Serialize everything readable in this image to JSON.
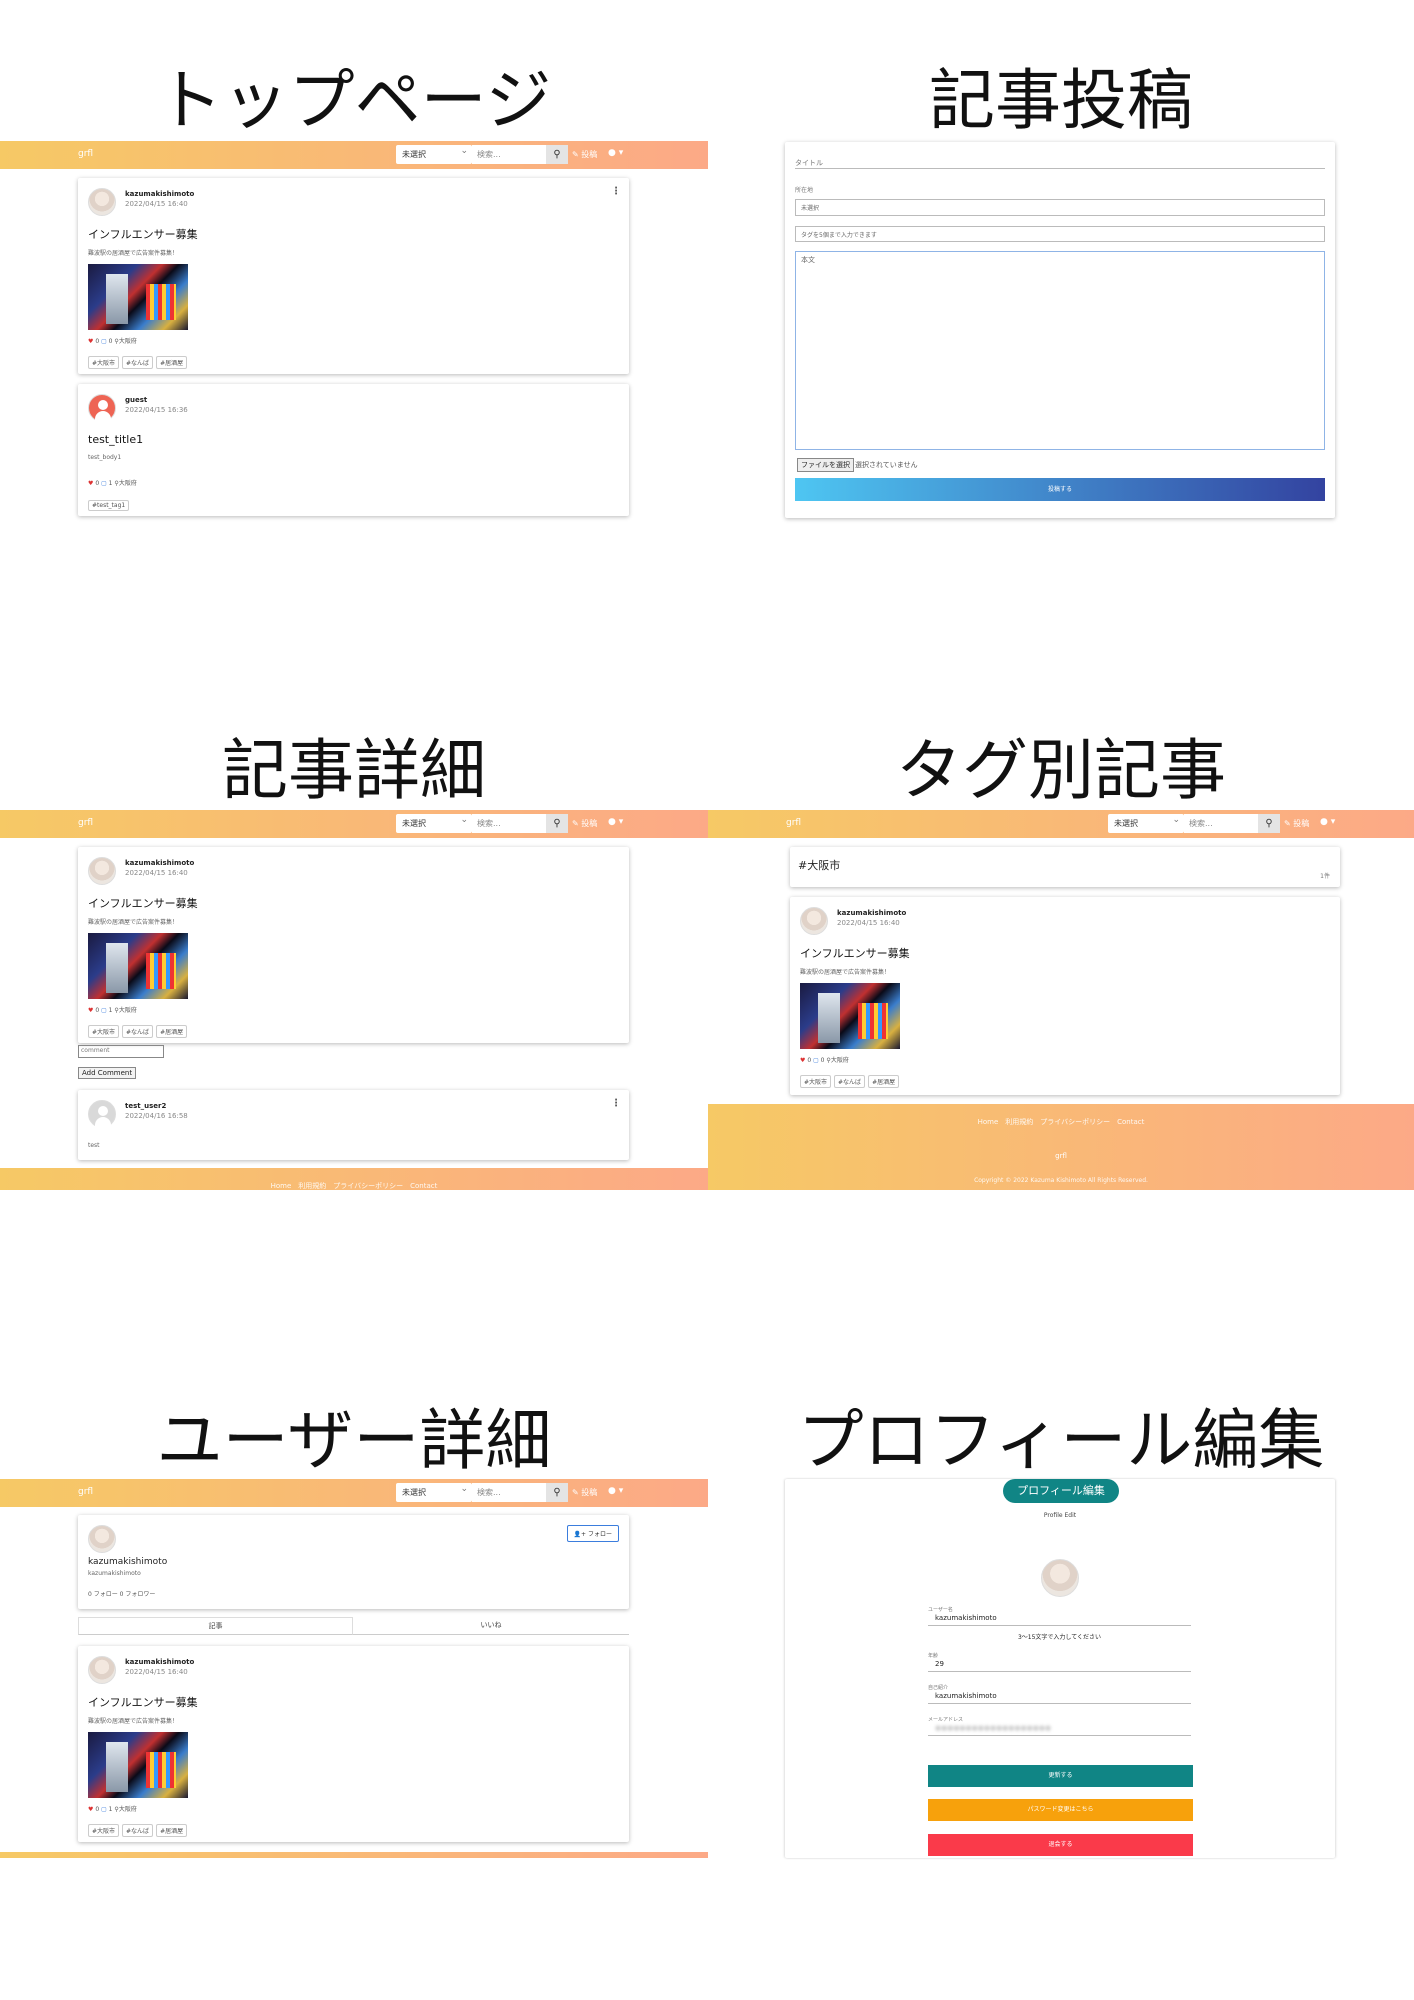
{
  "titles": {
    "top": "トップページ",
    "compose": "記事投稿",
    "detail": "記事詳細",
    "tag": "タグ別記事",
    "user": "ユーザー詳細",
    "profile": "プロフィール編集"
  },
  "nav": {
    "brand": "grfl",
    "select": "未選択",
    "search_placeholder": "検索...",
    "search_icon": "search-icon",
    "post": "✎ 投稿",
    "account": "● ▾"
  },
  "posts": {
    "p1": {
      "user": "kazumakishimoto",
      "date": "2022/04/15 16:40",
      "title": "インフルエンサー募集",
      "body": "難波駅の居酒屋で広告案件募集！",
      "likes": "0",
      "comments": "0",
      "comments_alt": "1",
      "location": "大阪府",
      "tags": [
        "#大阪市",
        "#なんば",
        "#居酒屋"
      ]
    },
    "p2": {
      "user": "guest",
      "date": "2022/04/15 16:36",
      "title": "test_title1",
      "body": "test_body1",
      "likes": "0",
      "comments": "1",
      "location": "大阪府",
      "tags": [
        "#test_tag1"
      ]
    }
  },
  "compose": {
    "title_label": "タイトル",
    "location_label": "所在地",
    "location_value": "未選択",
    "tag_placeholder": "タグを5個まで入力できます",
    "body_label": "本文",
    "file_button": "ファイルを選択",
    "file_status": "選択されていません",
    "submit": "投稿する"
  },
  "detail": {
    "comment_placeholder": "comment",
    "add_comment": "Add Comment",
    "comment_user": "test_user2",
    "comment_date": "2022/04/16 16:58",
    "comment_body": "test"
  },
  "footer": {
    "links": "Home　利用規約　プライバシーポリシー　Contact",
    "brand": "grfl",
    "copyright": "Copyright © 2022 Kazuma Kishimoto All Rights Reserved."
  },
  "tagpage": {
    "tag": "#大阪市",
    "count": "1件"
  },
  "user": {
    "display_name": "kazumakishimoto",
    "handle": "kazumakishimoto",
    "follow_counts": "0 フォロー  0 フォロワー",
    "follow_button": "フォロー",
    "tab_articles": "記事",
    "tab_likes": "いいね"
  },
  "profile": {
    "heading": "プロフィール編集",
    "sub": "Profile Edit",
    "username_label": "ユーザー名",
    "username": "kazumakishimoto",
    "username_hint": "3〜15文字で入力してください",
    "age_label": "年齢",
    "age": "29",
    "intro_label": "自己紹介",
    "intro": "kazumakishimoto",
    "email_label": "メールアドレス",
    "email": "●●●●●●●●●●●●●●●●●●●",
    "update": "更新する",
    "password": "パスワード変更はこちら",
    "withdraw": "退会する"
  },
  "colors": {
    "nav_start": "#f6c965",
    "nav_end": "#fca987",
    "teal": "#108585",
    "orange": "#f7a10c",
    "red": "#fa3a4a",
    "submit_start": "#4ec6f2",
    "submit_end": "#3343a0"
  }
}
